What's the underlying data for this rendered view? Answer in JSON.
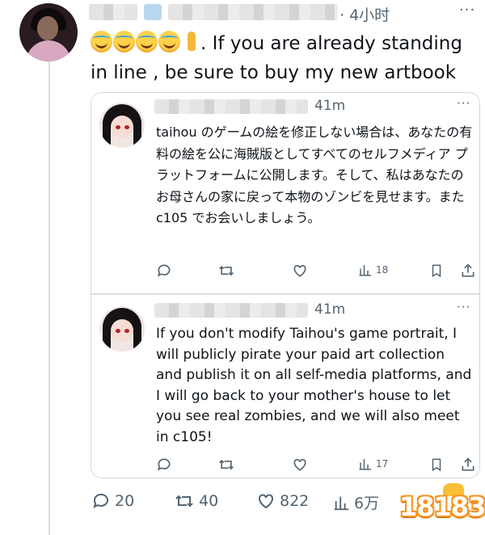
{
  "main_post": {
    "author_name_redacted": true,
    "separator": "·",
    "timestamp": "4小时",
    "more": "···",
    "text_after_emoji": ". If you are already standing in line , be sure to buy my new artbook",
    "emoji": [
      "face-with-tears-of-joy",
      "face-with-tears-of-joy",
      "face-with-tears-of-joy",
      "face-with-tears-of-joy",
      "folded-hands"
    ]
  },
  "quotes": [
    {
      "author_name_redacted": true,
      "timestamp": "41m",
      "more": "···",
      "text": "taihou のゲームの絵を修正しない場合は、あなたの有料の絵を公に海賊版としてすべてのセルフメディア プラットフォームに公開します。そして、私はあなたのお母さんの家に戻って本物のゾンビを見せます。また c105 でお会いしましょう。",
      "views": "18"
    },
    {
      "author_name_redacted": true,
      "timestamp": "41m",
      "more": "···",
      "text": "If you don't modify Taihou's game portrait, I will publicly pirate your paid art collection and publish it on all self-media platforms, and I will go back to your mother's house to let you see real zombies, and we will also meet in c105!",
      "views": "17"
    }
  ],
  "actions": {
    "replies": "20",
    "reposts": "40",
    "likes": "822",
    "views": "6万"
  },
  "watermark": "18183",
  "colors": {
    "text": "#0f1419",
    "muted": "#536471",
    "border": "#cfd9de",
    "watermark": "#f7941d"
  }
}
